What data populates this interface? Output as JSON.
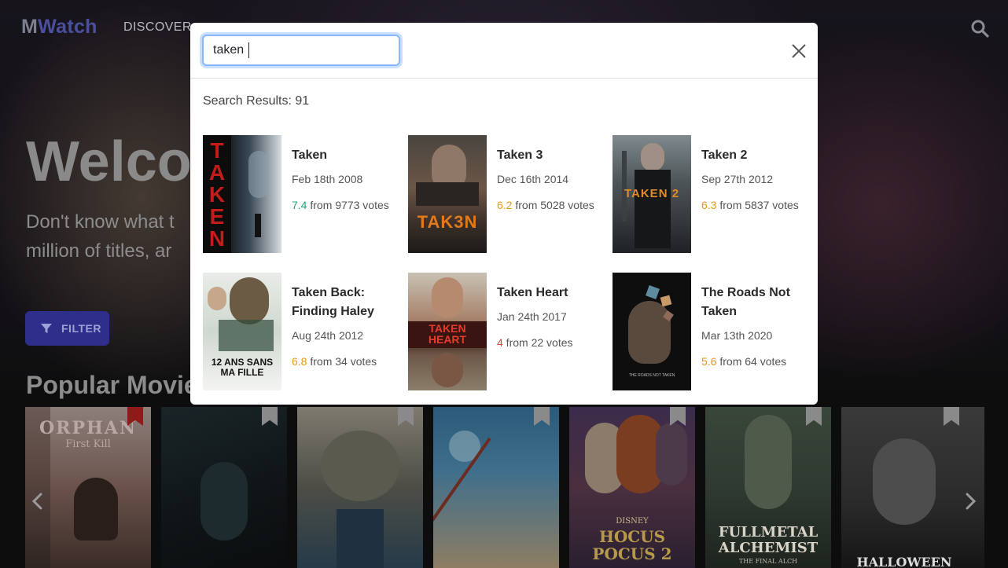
{
  "navbar": {
    "logo_m": "M",
    "logo_rest": "Watch",
    "discover": "DISCOVER",
    "search_icon": "search-icon"
  },
  "hero": {
    "title": "Welco",
    "subtitle": "Don't know what t million of titles, ar"
  },
  "filter": {
    "label": "FILTER",
    "icon": "filter-icon"
  },
  "popular": {
    "title": "Popular Movie",
    "cards": [
      {
        "poster_text": "ORPHAN",
        "poster_sub": "First Kill",
        "bookmarked": true
      },
      {
        "poster_text": "",
        "poster_sub": "",
        "bookmarked": false
      },
      {
        "poster_text": "",
        "poster_sub": "",
        "bookmarked": false
      },
      {
        "poster_text": "",
        "poster_sub": "",
        "bookmarked": false
      },
      {
        "poster_text": "HOCUS POCUS 2",
        "poster_sub": "DISNEY",
        "bookmarked": false
      },
      {
        "poster_text": "FULLMETAL ALCHEMIST",
        "poster_sub": "THE FINAL ALCH",
        "bookmarked": false
      },
      {
        "poster_text": "HALLOWEEN",
        "poster_sub": "",
        "bookmarked": false
      }
    ]
  },
  "modal": {
    "search_value": "taken",
    "results_label": "Search Results: 91",
    "results": [
      {
        "title": "Taken",
        "date": "Feb 18th 2008",
        "score": "7.4",
        "votes": " from 9773 votes",
        "poster_text": "TAKEN",
        "color": "#1fa971"
      },
      {
        "title": "Taken 3",
        "date": "Dec 16th 2014",
        "score": "6.2",
        "votes": " from 5028 votes",
        "poster_text": "TAK3N",
        "color": "#e69a12"
      },
      {
        "title": "Taken 2",
        "date": "Sep 27th 2012",
        "score": "6.3",
        "votes": " from 5837 votes",
        "poster_text": "TAKEN 2",
        "color": "#e69a12"
      },
      {
        "title": "Taken Back: Finding Haley",
        "date": "Aug 24th 2012",
        "score": "6.8",
        "votes": " from 34 votes",
        "poster_text": "12 ANS SANS MA FILLE",
        "color": "#e69a12"
      },
      {
        "title": "Taken Heart",
        "date": "Jan 24th 2017",
        "score": "4",
        "votes": " from 22 votes",
        "poster_text": "TAKEN HEART",
        "color": "#e0443a"
      },
      {
        "title": "The Roads Not Taken",
        "date": "Mar 13th 2020",
        "score": "5.6",
        "votes": " from 64 votes",
        "poster_text": "THE ROADS NOT TAKEN",
        "color": "#e69a12"
      }
    ]
  },
  "colors": {
    "accent": "#2d2f8a",
    "focus_ring": "#86b7fe"
  }
}
